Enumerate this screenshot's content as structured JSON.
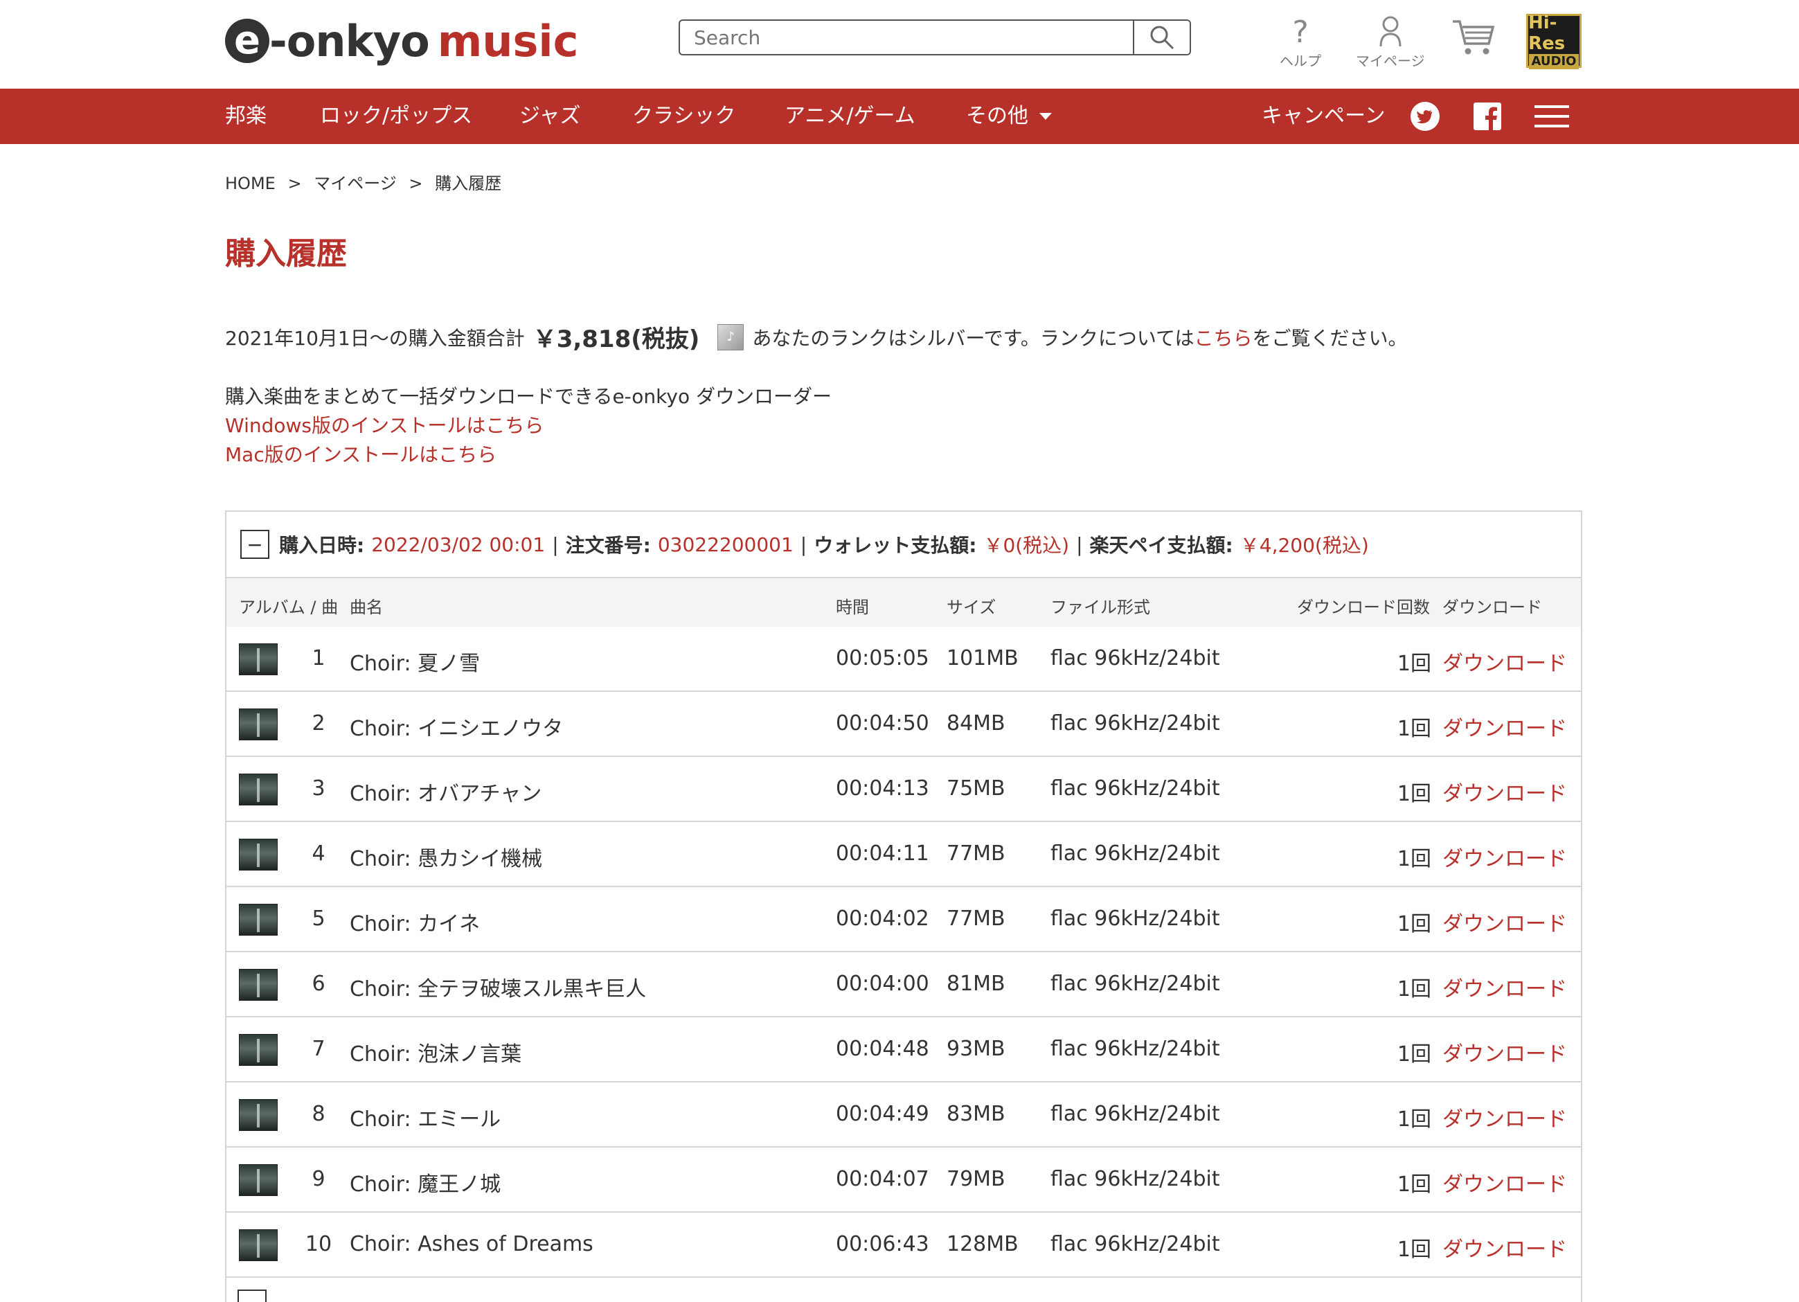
{
  "header": {
    "logo_e": "e",
    "logo_onkyo": "-onkyo",
    "logo_music": "music",
    "search_placeholder": "Search",
    "help_label": "ヘルプ",
    "mypage_label": "マイページ",
    "hires_top": "Hi-Res",
    "hires_bottom": "AUDIO"
  },
  "nav": {
    "items": [
      "邦楽",
      "ロック/ポップス",
      "ジャズ",
      "クラシック",
      "アニメ/ゲーム",
      "その他"
    ],
    "campaign": "キャンペーン"
  },
  "breadcrumb": [
    "HOME",
    ">",
    "マイページ",
    ">",
    "購入履歴"
  ],
  "page_title": "購入履歴",
  "summary": {
    "period_text": "2021年10月1日～の購入金額合計",
    "amount": "￥3,818(税抜)",
    "rank_text_1": "あなたのランクはシルバーです。ランクについては",
    "rank_link": "こちら",
    "rank_text_2": "をご覧ください。"
  },
  "downloader": {
    "description": "購入楽曲をまとめて一括ダウンロードできるe-onkyo ダウンローダー",
    "windows_link": "Windows版のインストールはこちら",
    "mac_link": "Mac版のインストールはこちら"
  },
  "order": {
    "collapse_symbol": "−",
    "date_label": "購入日時:",
    "date_value": "2022/03/02 00:01",
    "number_label": "注文番号:",
    "number_value": "03022200001",
    "wallet_label": "ウォレット支払額:",
    "wallet_value": "￥0(税込)",
    "rakuten_label": "楽天ペイ支払額:",
    "rakuten_value": "￥4,200(税込)",
    "sep": "|",
    "columns": {
      "album_track": "アルバム / 曲",
      "title": "曲名",
      "time": "時間",
      "size": "サイズ",
      "format": "ファイル形式",
      "count": "ダウンロード回数",
      "download": "ダウンロード"
    },
    "rows": [
      {
        "no": "1",
        "title": "Choir: 夏ノ雪",
        "time": "00:05:05",
        "size": "101MB",
        "format": "flac 96kHz/24bit",
        "count": "1回",
        "download": "ダウンロード"
      },
      {
        "no": "2",
        "title": "Choir: イニシエノウタ",
        "time": "00:04:50",
        "size": "84MB",
        "format": "flac 96kHz/24bit",
        "count": "1回",
        "download": "ダウンロード"
      },
      {
        "no": "3",
        "title": "Choir: オバアチャン",
        "time": "00:04:13",
        "size": "75MB",
        "format": "flac 96kHz/24bit",
        "count": "1回",
        "download": "ダウンロード"
      },
      {
        "no": "4",
        "title": "Choir: 愚カシイ機械",
        "time": "00:04:11",
        "size": "77MB",
        "format": "flac 96kHz/24bit",
        "count": "1回",
        "download": "ダウンロード"
      },
      {
        "no": "5",
        "title": "Choir: カイネ",
        "time": "00:04:02",
        "size": "77MB",
        "format": "flac 96kHz/24bit",
        "count": "1回",
        "download": "ダウンロード"
      },
      {
        "no": "6",
        "title": "Choir: 全テヲ破壊スル黒キ巨人",
        "time": "00:04:00",
        "size": "81MB",
        "format": "flac 96kHz/24bit",
        "count": "1回",
        "download": "ダウンロード"
      },
      {
        "no": "7",
        "title": "Choir: 泡沫ノ言葉",
        "time": "00:04:48",
        "size": "93MB",
        "format": "flac 96kHz/24bit",
        "count": "1回",
        "download": "ダウンロード"
      },
      {
        "no": "8",
        "title": "Choir: エミール",
        "time": "00:04:49",
        "size": "83MB",
        "format": "flac 96kHz/24bit",
        "count": "1回",
        "download": "ダウンロード"
      },
      {
        "no": "9",
        "title": "Choir: 魔王ノ城",
        "time": "00:04:07",
        "size": "79MB",
        "format": "flac 96kHz/24bit",
        "count": "1回",
        "download": "ダウンロード"
      },
      {
        "no": "10",
        "title": "Choir: Ashes of Dreams",
        "time": "00:06:43",
        "size": "128MB",
        "format": "flac 96kHz/24bit",
        "count": "1回",
        "download": "ダウンロード"
      }
    ]
  },
  "colors": {
    "brand_red": "#b8302a",
    "text": "#333333",
    "border": "#d5d5d5"
  }
}
